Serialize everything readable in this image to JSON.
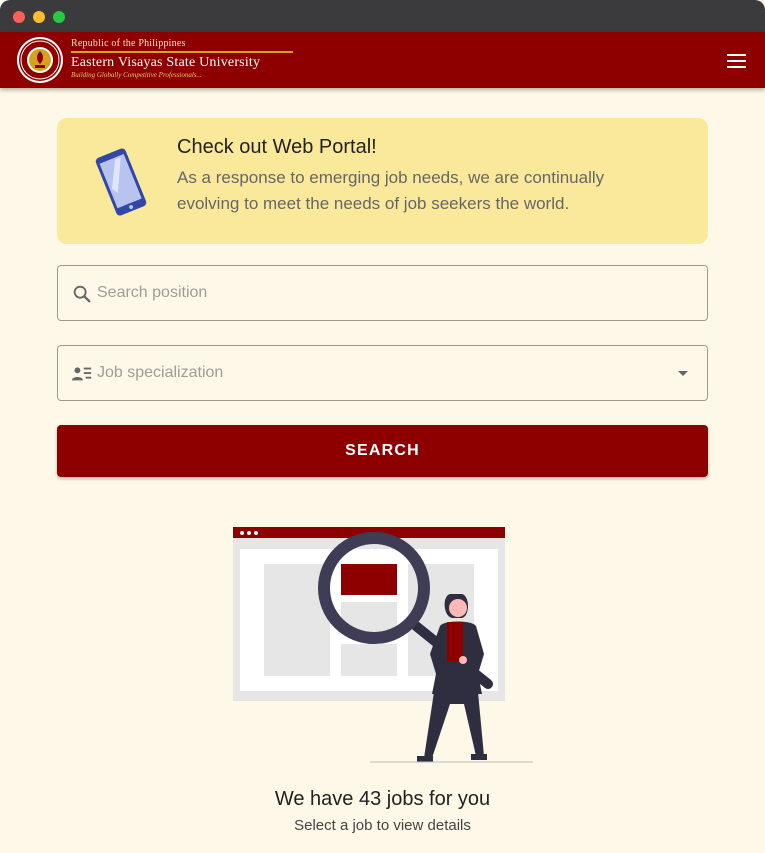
{
  "header": {
    "republic": "Republic of the Philippines",
    "university": "Eastern Visayas State University",
    "tagline": "Building Globally Competitive Professionals..."
  },
  "promo": {
    "title": "Check out Web Portal!",
    "text": "As a response to emerging job needs, we are continually evolving to meet the needs of job seekers the world."
  },
  "search": {
    "placeholder": "Search position"
  },
  "specialization": {
    "placeholder": "Job specialization"
  },
  "search_button": {
    "label": "SEARCH"
  },
  "results": {
    "count_text": "We have 43 jobs for you",
    "hint": "Select a job to view details"
  },
  "icons": {
    "menu": "hamburger-menu-icon",
    "search": "magnifier-icon",
    "specialization": "person-list-icon",
    "dropdown": "caret-down-icon",
    "promo": "smartphone-icon"
  },
  "colors": {
    "brand": "#8e0000",
    "page_background": "#fdf8e7",
    "promo_background": "#fbe99b",
    "accent_gold": "#d6a21d"
  }
}
